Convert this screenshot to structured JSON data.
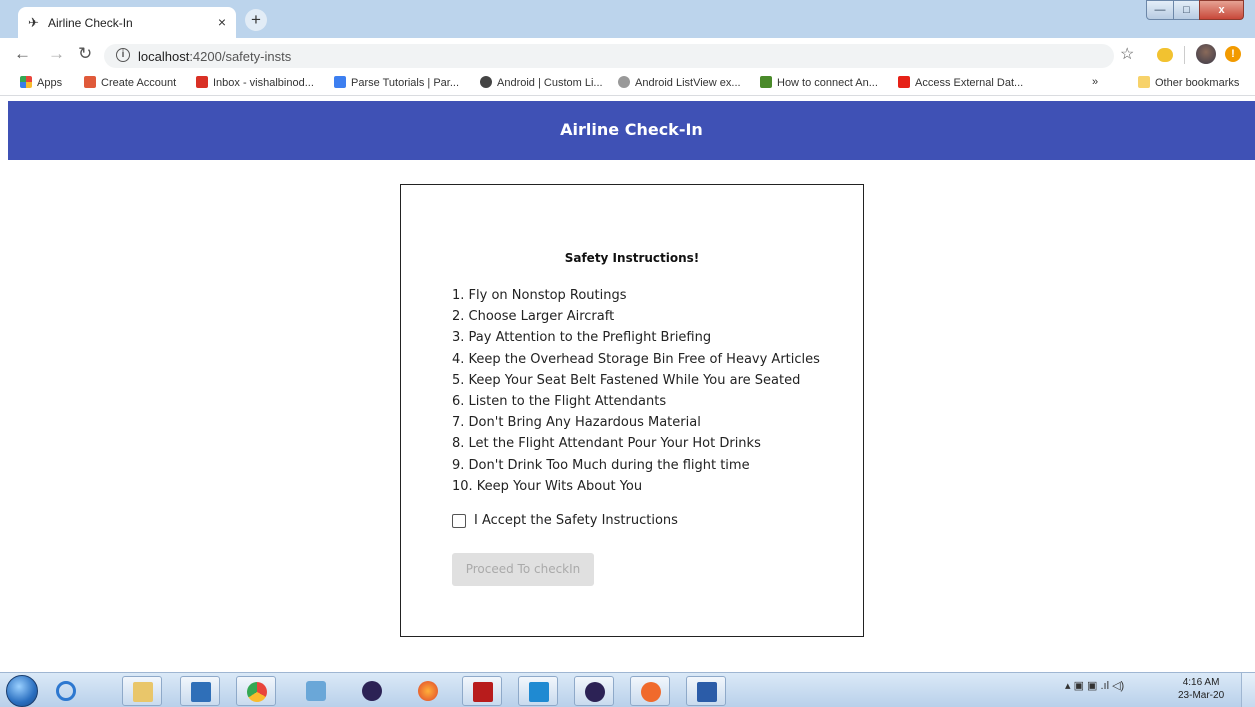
{
  "browser": {
    "tab": {
      "favicon": "airplane-icon",
      "title": "Airline Check-In",
      "close": "×"
    },
    "new_tab": "+",
    "window_controls": {
      "minimize": "—",
      "maximize": "□",
      "close": "x"
    },
    "url": {
      "host": "localhost",
      "path": ":4200/safety-insts"
    },
    "bookmarks": [
      {
        "label": "Apps",
        "icon": "apps-grid-icon",
        "color": "#e8453c"
      },
      {
        "label": "Create Account",
        "icon": "account-icon",
        "color": "#e05a3a"
      },
      {
        "label": "Inbox - vishalbinod...",
        "icon": "gmail-icon",
        "color": "#d93025"
      },
      {
        "label": "Parse Tutorials | Par...",
        "icon": "parse-icon",
        "color": "#3d7ff0"
      },
      {
        "label": "Android | Custom Li...",
        "icon": "globe-icon",
        "color": "#444444"
      },
      {
        "label": "Android ListView ex...",
        "icon": "listview-icon",
        "color": "#777777"
      },
      {
        "label": "How to connect An...",
        "icon": "android-icon",
        "color": "#4a8a2a"
      },
      {
        "label": "Access External Dat...",
        "icon": "youtube-icon",
        "color": "#e62117"
      }
    ],
    "overflow": "»",
    "other_bookmarks": "Other bookmarks"
  },
  "app": {
    "header_title": "Airline Check-In",
    "card": {
      "title": "Safety Instructions!",
      "instructions": [
        "1. Fly on Nonstop Routings",
        "2. Choose Larger Aircraft",
        "3. Pay Attention to the Preflight Briefing",
        "4. Keep the Overhead Storage Bin Free of Heavy Articles",
        "5. Keep Your Seat Belt Fastened While You are Seated",
        "6. Listen to the Flight Attendants",
        "7. Don't Bring Any Hazardous Material",
        "8. Let the Flight Attendant Pour Your Hot Drinks",
        "9. Don't Drink Too Much during the flight time",
        "10. Keep Your Wits About You"
      ],
      "accept_label": "I Accept the Safety Instructions",
      "accept_checked": false,
      "proceed_label": "Proceed To checkIn",
      "proceed_disabled": true
    }
  },
  "taskbar": {
    "apps": [
      "internet-explorer-icon",
      "file-explorer-icon",
      "media-player-icon",
      "chrome-icon",
      "virtualbox-icon",
      "eclipse-icon",
      "firefox-icon",
      "acrobat-icon",
      "vscode-icon",
      "eclipse-icon",
      "postman-icon",
      "word-icon"
    ],
    "time": "4:16 AM",
    "date": "23-Mar-20"
  }
}
